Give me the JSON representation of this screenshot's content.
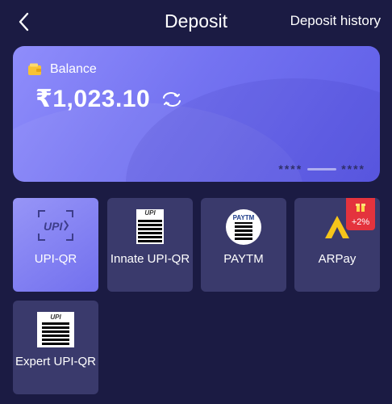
{
  "header": {
    "title": "Deposit",
    "history_label": "Deposit history"
  },
  "balance": {
    "label": "Balance",
    "amount": "₹1,023.10",
    "mask_left": "****",
    "mask_right": "****"
  },
  "methods": [
    {
      "label": "UPI-QR",
      "icon": "upi-scan-icon",
      "active": true
    },
    {
      "label": "Innate UPI-QR",
      "icon": "upi-qr-icon",
      "active": false
    },
    {
      "label": "PAYTM",
      "icon": "paytm-qr-icon",
      "active": false
    },
    {
      "label": "ARPay",
      "icon": "arpay-logo-icon",
      "active": false,
      "badge": "+2%"
    },
    {
      "label": "Expert UPI-QR",
      "icon": "upi-qr-icon",
      "active": false
    }
  ],
  "colors": {
    "background": "#1b1b43",
    "card": "#7d7cf4",
    "tile": "#3a3a6c",
    "active_tile": "#8482f3",
    "badge": "#e4333d",
    "arpay": "#f6c51a"
  }
}
